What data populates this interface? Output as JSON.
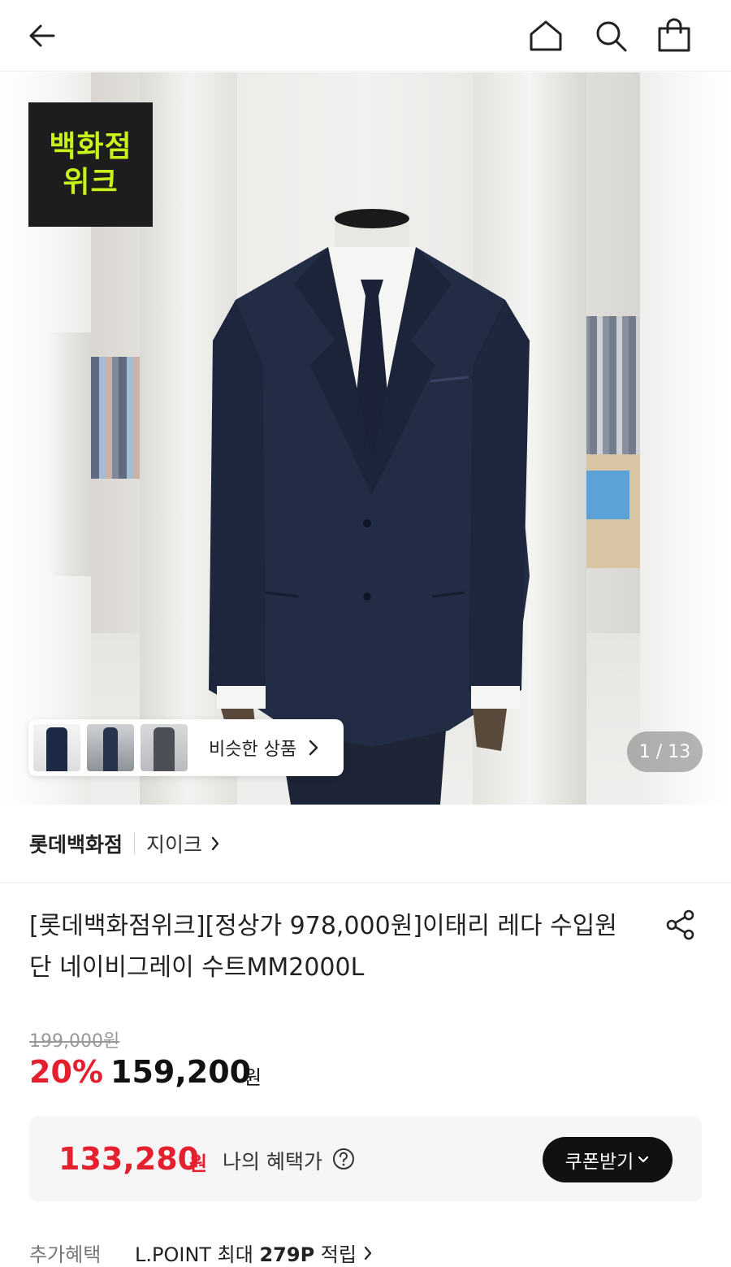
{
  "header": {
    "back_icon": "arrow-left-icon",
    "home_icon": "home-icon",
    "search_icon": "search-icon",
    "bag_icon": "shopping-bag-icon"
  },
  "hero": {
    "badge_line1": "백화점",
    "badge_line2": "위크",
    "similar_label": "비슷한 상품",
    "counter": "1 / 13"
  },
  "brand": {
    "store": "롯데백화점",
    "name": "지이크"
  },
  "product": {
    "title": "[롯데백화점위크][정상가 978,000원]이태리 레다 수입원단 네이비그레이 수트MM2000L",
    "original_price": "199,000원",
    "discount": "20%",
    "price": "159,200",
    "price_unit": "원"
  },
  "benefit": {
    "price": "133,280",
    "price_unit": "원",
    "label": "나의 혜택가",
    "coupon_label": "쿠폰받기"
  },
  "extra": {
    "label": "추가혜택",
    "text_prefix": "L.POINT 최대 ",
    "points": "279P",
    "text_suffix": " 적립"
  },
  "colors": {
    "accent_red": "#e5202e",
    "badge_bg": "#1d1d1d",
    "badge_text": "#c9f21d"
  }
}
